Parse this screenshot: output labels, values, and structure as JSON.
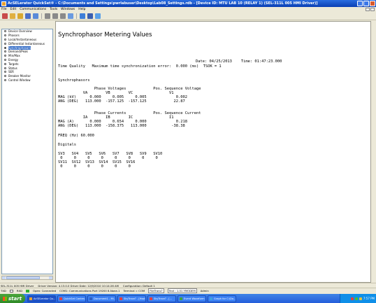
{
  "window": {
    "title": "AcSELerator QuickSet® - C:\\Documents and Settings\\pwrlabuser\\Desktop\\Lab08_Settings.rdb - [Device ID: MTU LAB 10 (RELAY 1) (SEL-311L 005 HMI Driver)]",
    "menu": [
      "File",
      "Edit",
      "Communications",
      "Tools",
      "Windows",
      "Help"
    ]
  },
  "toolbar": {
    "icons": [
      {
        "name": "new-icon",
        "color": "#c84a4a"
      },
      {
        "name": "open-icon",
        "color": "#e0b040"
      },
      {
        "name": "folder-icon",
        "color": "#d8a830"
      },
      {
        "name": "save-icon",
        "color": "#4a6fc8"
      },
      {
        "name": "settings-icon",
        "color": "#5a8ad8"
      },
      {
        "name": "read-icon",
        "color": "#8a8a8a"
      },
      {
        "name": "send-icon",
        "color": "#8a8a8a"
      },
      {
        "name": "print-icon",
        "color": "#8a8a8a"
      },
      {
        "name": "help-icon",
        "color": "#6a9ae0"
      },
      {
        "name": "connect-icon",
        "color": "#3f7fd8"
      },
      {
        "name": "terminal-icon",
        "color": "#3a5fb0"
      },
      {
        "name": "hmi-icon",
        "color": "#5aa0e8"
      }
    ]
  },
  "tree": {
    "items": [
      {
        "label": "Device Overview",
        "selected": false
      },
      {
        "label": "Phasors",
        "selected": false
      },
      {
        "label": "Local/Instantaneous",
        "selected": false
      },
      {
        "label": "Differential Instantaneous",
        "selected": false
      },
      {
        "label": "Synchrophasors",
        "selected": true
      },
      {
        "label": "Demand/Peak",
        "selected": false
      },
      {
        "label": "Min/Max",
        "selected": false
      },
      {
        "label": "Energy",
        "selected": false
      },
      {
        "label": "Targets",
        "selected": false
      },
      {
        "label": "Status",
        "selected": false
      },
      {
        "label": "SER",
        "selected": false
      },
      {
        "label": "Breaker Monitor",
        "selected": false
      },
      {
        "label": "Control Window",
        "selected": false
      }
    ]
  },
  "disable_button": "Disable Update",
  "page": {
    "heading": "Synchrophasor Metering Values",
    "date_line": "Date: 04/25/2013    Time: 01:47:23.000",
    "tq_line": "Time Quality   Maximum time synchronization error:  0.000 (ms)  TSOK = 1",
    "sync_title": "Synchrophasors",
    "voltage_block": "                Phase Voltages            Pos. Sequence Voltage\n           VA        VB        VC                V1\nMAG (kV)      0.000     0.005     0.005             0.002\nANG (DEG)   113.000  -157.125  -157.125            22.87",
    "current_block": "                Phase Currents            Pos. Sequence Current\n           IA        IB        IC                I1\nMAG (A)       0.000     0.654     0.000             0.218\nANG (DEG)   113.000  -158.375   113.000           -38.38",
    "freq_line": "FREQ (Hz) 60.000",
    "digitals_title": "Digitals",
    "digitals_block": "SV3   SV4   SV5   SV6   SV7   SV8   SV9   SV10\n 0     0     0     0     0     0     0     0\nSV11  SV12  SV13  SV14  SV15  SV16\n 0     0     0     0     0     0"
  },
  "status1": {
    "driver": "SEL-311L 005 HMI Driver",
    "driver_version": "Driver Version: 4.13.0.0  Driver Date: 12/9/2010 10:14:26 AM",
    "config": "Configuration: Default 1"
  },
  "status2": {
    "tx": "TXD",
    "rx": "RXD",
    "rx_led_color": "#2fb02f",
    "connection": "Open: Connected",
    "port": "COM1: Communications Port  19200  8-None-1",
    "terminal": "Terminal = COM",
    "file_transfer": "FileTrans?",
    "text_label": "Text : 1.01 YMODEM",
    "admin": "Admin"
  },
  "taskbar": {
    "start_label": "start",
    "tasks": [
      {
        "label": "AcSELerator Qu...",
        "color": "#e8a030",
        "active": true
      },
      {
        "label": "QuickSet Conten...",
        "color": "#e04040",
        "active": false
      },
      {
        "label": "Document1 - Mi...",
        "color": "#3060c0",
        "active": false
      },
      {
        "label": "SkyTrace? - [Hsst...",
        "color": "#e04040",
        "active": false
      },
      {
        "label": "SkyTrace? - [...",
        "color": "#e04040",
        "active": false
      },
      {
        "label": "Event Waveform",
        "color": "#40a040",
        "active": false
      },
      {
        "label": "Graph for C:\\Do...",
        "color": "#40a0e0",
        "active": false
      }
    ],
    "time": "7:57 PM"
  }
}
